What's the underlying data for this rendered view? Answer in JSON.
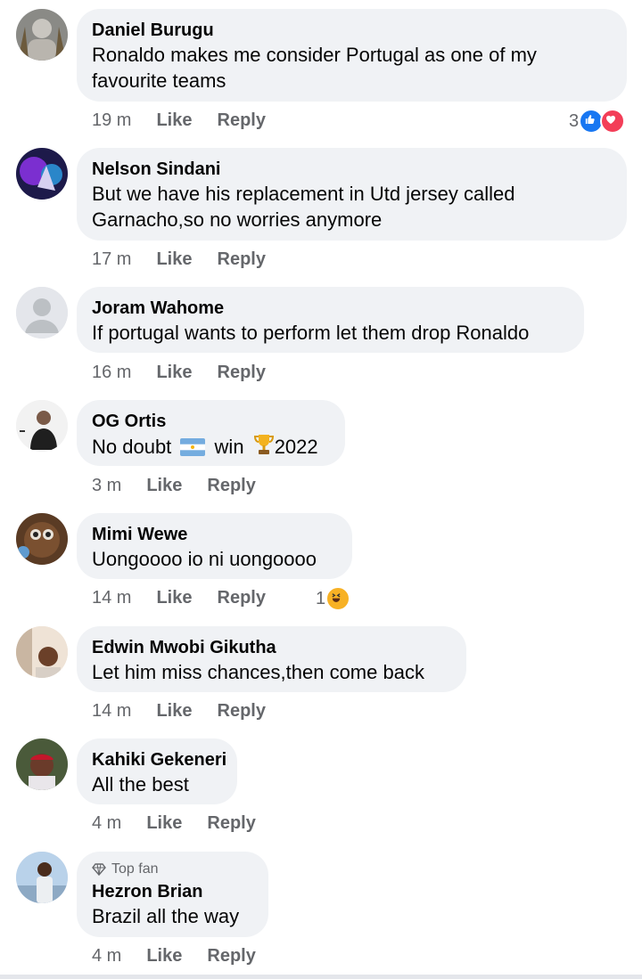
{
  "comments": [
    {
      "name": "Daniel Burugu",
      "text": "Ronaldo makes me consider Portugal as one of my favourite teams",
      "time": "19 m",
      "like": "Like",
      "reply": "Reply",
      "reaction_count": "3"
    },
    {
      "name": "Nelson Sindani",
      "text": "But we have his replacement in Utd jersey called Garnacho,so no worries anymore",
      "time": "17 m",
      "like": "Like",
      "reply": "Reply"
    },
    {
      "name": "Joram Wahome",
      "text": "If portugal wants to perform let them drop Ronaldo",
      "time": "16 m",
      "like": "Like",
      "reply": "Reply"
    },
    {
      "name": "OG Ortis",
      "text_before": "No doubt",
      "text_mid": "win",
      "text_after": "2022",
      "time": "3 m",
      "like": "Like",
      "reply": "Reply"
    },
    {
      "name": "Mimi Wewe",
      "text": "Uongoooo io ni uongoooo",
      "time": "14 m",
      "like": "Like",
      "reply": "Reply",
      "reaction_count": "1"
    },
    {
      "name": "Edwin Mwobi Gikutha",
      "text": "Let him miss chances,then come back",
      "time": "14 m",
      "like": "Like",
      "reply": "Reply"
    },
    {
      "name": "Kahiki Gekeneri",
      "text": "All the best",
      "time": "4 m",
      "like": "Like",
      "reply": "Reply"
    },
    {
      "badge": "Top fan",
      "name": "Hezron Brian",
      "text": "Brazil all the way",
      "time": "4 m",
      "like": "Like",
      "reply": "Reply"
    }
  ],
  "colors": {
    "bubble": "#f0f2f5",
    "meta": "#65676b",
    "like_blue": "#1877f2",
    "love_red": "#f33e58",
    "haha_yellow": "#f7b125"
  },
  "icons": [
    "thumbs-up-icon",
    "heart-icon",
    "haha-emoji-icon",
    "trophy-emoji-icon",
    "argentina-flag-icon",
    "diamond-icon"
  ]
}
